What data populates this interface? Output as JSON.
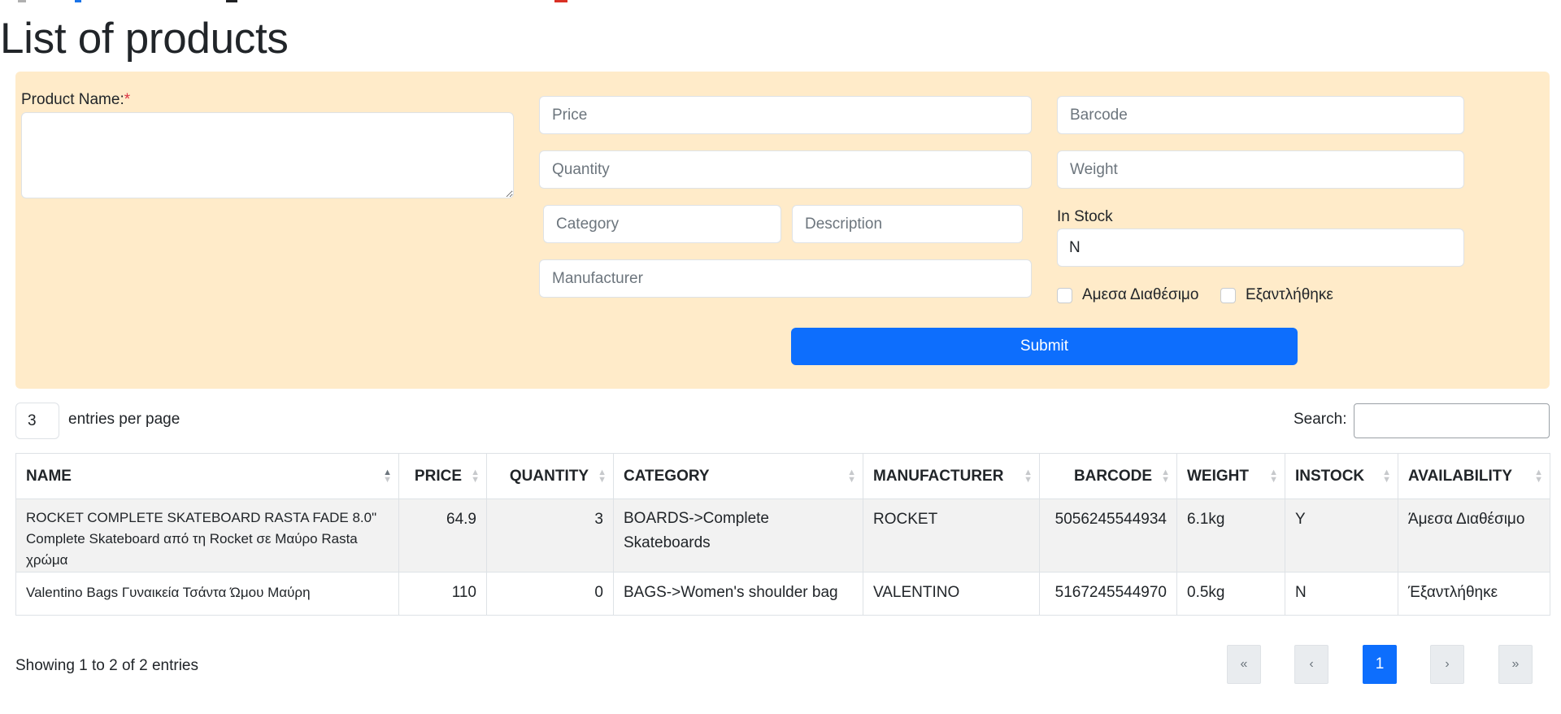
{
  "page_title": "List of products",
  "form": {
    "product_name_label": "Product Name:",
    "required_mark": "*",
    "price_placeholder": "Price",
    "barcode_placeholder": "Barcode",
    "quantity_placeholder": "Quantity",
    "weight_placeholder": "Weight",
    "category_placeholder": "Category",
    "description_placeholder": "Description",
    "manufacturer_placeholder": "Manufacturer",
    "in_stock_label": "In Stock",
    "in_stock_value": "N",
    "availability_options": [
      "Αμεσα Διαθέσιμο",
      "Εξαντλήθηκε"
    ],
    "submit_label": "Submit"
  },
  "table_controls": {
    "entries_value": "3",
    "entries_label": "entries per page",
    "search_label": "Search:"
  },
  "table": {
    "columns": [
      "NAME",
      "PRICE",
      "QUANTITY",
      "CATEGORY",
      "MANUFACTURER",
      "BARCODE",
      "WEIGHT",
      "INSTOCK",
      "AVAILABILITY"
    ],
    "rows": [
      {
        "name": "ROCKET COMPLETE SKATEBOARD RASTA FADE 8.0\" Complete Skateboard από τη Rocket σε Μαύρο Rasta χρώμα",
        "price": "64.9",
        "quantity": "3",
        "category": "BOARDS->Complete Skateboards",
        "manufacturer": "ROCKET",
        "barcode": "5056245544934",
        "weight": "6.1kg",
        "instock": "Y",
        "availability": "Άμεσα Διαθέσιμο"
      },
      {
        "name": "Valentino Bags Γυναικεία Τσάντα Ώμου Μαύρη",
        "price": "110",
        "quantity": "0",
        "category": "BAGS->Women's shoulder bag",
        "manufacturer": "VALENTINO",
        "barcode": "5167245544970",
        "weight": "0.5kg",
        "instock": "N",
        "availability": "Έξαντλήθηκε"
      }
    ]
  },
  "footer": {
    "info": "Showing 1 to 2 of 2 entries",
    "pagination": {
      "first": "«",
      "prev": "‹",
      "current": "1",
      "next": "›",
      "last": "»"
    }
  },
  "colors": {
    "form_background": "#ffebc9",
    "primary": "#0d6efd",
    "required": "#dc3545",
    "striped_row": "#f2f2f2"
  }
}
